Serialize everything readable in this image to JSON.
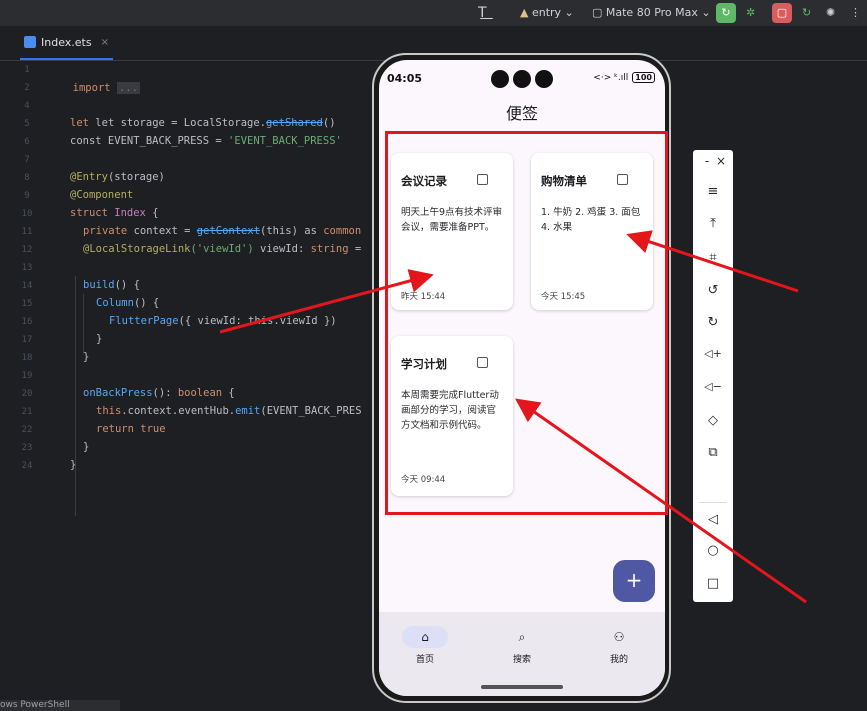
{
  "toolbar": {
    "text_icon": "T͟",
    "module": "entry",
    "device": "Mate 80 Pro Max",
    "colors": {
      "run": "#5fb865",
      "stop": "#db5c5c"
    }
  },
  "editor": {
    "tab_name": "Index.ets",
    "tab_close": "×",
    "line_numbers": [
      "1",
      "2",
      "4",
      "5",
      "6",
      "7",
      "8",
      "9",
      "10",
      "11",
      "12",
      "13",
      "14",
      "15",
      "16",
      "17",
      "18",
      "19",
      "20",
      "21",
      "22",
      "23",
      "24"
    ],
    "code": {
      "l2_kw": "import",
      "l2_fold": "...",
      "l5_a": "let storage = LocalStorage.",
      "l5_b": "getShared",
      "l5_c": "()",
      "l6_a": "const EVENT_BACK_PRESS = ",
      "l6_b": "'EVENT_BACK_PRESS'",
      "l8_a": "@Entry",
      "l8_b": "(storage)",
      "l9": "@Component",
      "l10_a": "struct ",
      "l10_b": "Index",
      "l10_c": " {",
      "l11_a": "private ",
      "l11_b": "context = ",
      "l11_c": "getContext",
      "l11_d": "(this) as ",
      "l11_e": "common",
      "l12_a": "@LocalStorageLink",
      "l12_b": "('viewId')",
      "l12_c": " viewId: ",
      "l12_d": "string",
      "l12_e": " =",
      "l14_a": "build",
      "l14_b": "() {",
      "l15_a": "Column",
      "l15_b": "() {",
      "l16_a": "FlutterPage",
      "l16_b": "({ viewId: this.viewId })",
      "l17": "}",
      "l18": "}",
      "l20_a": "onBackPress",
      "l20_b": "(): ",
      "l20_c": "boolean",
      "l20_d": " {",
      "l21_a": "this",
      "l21_b": ".context.eventHub.",
      "l21_c": "emit",
      "l21_d": "(EVENT_BACK_PRES",
      "l22_a": "return ",
      "l22_b": "true",
      "l23": "}",
      "l24": "}"
    },
    "bottom_hint": "ows PowerShell"
  },
  "phone": {
    "status": {
      "time": "04:05",
      "signal": "<·> ᵏ.ıll",
      "battery": "100"
    },
    "title": "便签",
    "notes": [
      {
        "title": "会议记录",
        "body": "明天上午9点有技术评审会议，需要准备PPT。",
        "time": "昨天 15:44"
      },
      {
        "title": "购物清单",
        "body": "1. 牛奶 2. 鸡蛋 3. 面包 4. 水果",
        "time": "今天 15:45"
      },
      {
        "title": "学习计划",
        "body": "本周需要完成Flutter动画部分的学习，阅读官方文档和示例代码。",
        "time": "今天 09:44"
      }
    ],
    "fab": "+",
    "nav": [
      {
        "icon": "home-icon",
        "glyph": "⌂",
        "label": "首页"
      },
      {
        "icon": "search-icon",
        "glyph": "⌕",
        "label": "搜索"
      },
      {
        "icon": "person-icon",
        "glyph": "⚇",
        "label": "我的"
      }
    ]
  },
  "sidebar": {
    "min": "-",
    "close": "×",
    "items": [
      {
        "icon": "menu-icon",
        "glyph": "≡"
      },
      {
        "icon": "pin-top-icon",
        "glyph": "⤒"
      },
      {
        "icon": "crop-icon",
        "glyph": "⌗"
      },
      {
        "icon": "rotate-icon",
        "glyph": "↺"
      },
      {
        "icon": "rotate-cw-icon",
        "glyph": "↻"
      },
      {
        "icon": "volume-up-icon",
        "glyph": "◁+"
      },
      {
        "icon": "volume-down-icon",
        "glyph": "◁−"
      },
      {
        "icon": "shake-icon",
        "glyph": "◇"
      },
      {
        "icon": "multi-screen-icon",
        "glyph": "⧉"
      },
      {
        "icon": "back-icon",
        "glyph": "◁"
      },
      {
        "icon": "home-circle-icon",
        "glyph": "○"
      },
      {
        "icon": "recents-icon",
        "glyph": "□"
      }
    ]
  },
  "annotation": {
    "highlight_color": "#e3161c"
  }
}
